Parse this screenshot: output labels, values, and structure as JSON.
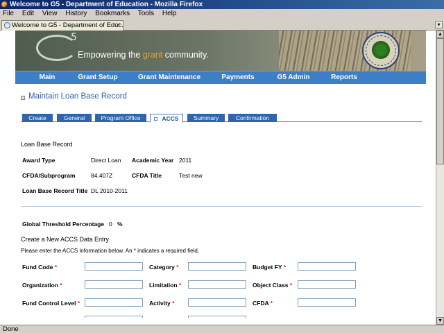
{
  "window": {
    "title": "Welcome to G5 - Department of Education - Mozilla Firefox"
  },
  "menu": [
    "File",
    "Edit",
    "View",
    "History",
    "Bookmarks",
    "Tools",
    "Help"
  ],
  "browser_tab": {
    "label": "Welcome to G5 - Department of Educ...",
    "close": "✕"
  },
  "status": {
    "text": "Done"
  },
  "banner": {
    "g5_superscript": "5",
    "tagline_pre": "Empowering the ",
    "tagline_accent": "grant",
    "tagline_post": " community."
  },
  "nav": [
    "Main",
    "Grant Setup",
    "Grant Maintenance",
    "Payments",
    "G5 Admin",
    "Reports"
  ],
  "page_title": "Maintain Loan Base Record",
  "tabs": [
    "Create",
    "General",
    "Program Office",
    "ACCS",
    "Summary",
    "Confirmation"
  ],
  "active_tab": "ACCS",
  "section_title": "Loan Base Record",
  "record": {
    "award_type_label": "Award Type",
    "award_type_value": "Direct Loan",
    "academic_year_label": "Academic Year",
    "academic_year_value": "2011",
    "cfda_sub_label": "CFDA/Subprogram",
    "cfda_sub_value": "84.407Z",
    "cfda_title_label": "CFDA Title",
    "cfda_title_value": "Test new",
    "lbr_title_label": "Loan Base Record Title",
    "lbr_title_value": "DL 2010-2011"
  },
  "threshold": {
    "label": "Global Threshold Percentage",
    "value": "0",
    "unit": "%"
  },
  "accs_heading": "Create a New ACCS Data Entry",
  "instructions": "Please enter the ACCS information below. An * indicates a required field.",
  "fields": {
    "fund_code": {
      "label": "Fund Code",
      "value": ""
    },
    "category": {
      "label": "Category",
      "value": ""
    },
    "budget_fy": {
      "label": "Budget FY",
      "value": ""
    },
    "organization": {
      "label": "Organization",
      "value": ""
    },
    "limitation": {
      "label": "Limitation",
      "value": ""
    },
    "object_class": {
      "label": "Object Class",
      "value": ""
    },
    "fund_control_level": {
      "label": "Fund Control Level",
      "value": ""
    },
    "activity": {
      "label": "Activity",
      "value": ""
    },
    "cfda": {
      "label": "CFDA",
      "value": ""
    }
  },
  "required_mark": "*"
}
